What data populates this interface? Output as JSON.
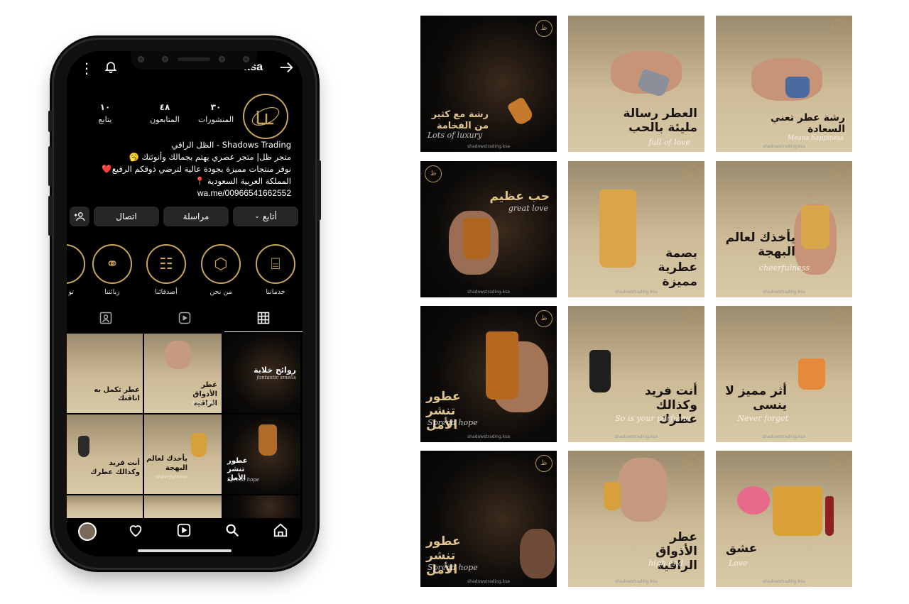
{
  "profile": {
    "username": "ksa",
    "stats": [
      {
        "value": "١٠",
        "label": "يتابع"
      },
      {
        "value": "٤٨",
        "label": "المتابعون"
      },
      {
        "value": "٣٠",
        "label": "المنشورات"
      }
    ],
    "bio_lines": [
      "Shadows Trading - الظل الراقي",
      "متجر ظل| متجر عصري يهتم بجمالك وأنوثتك 🥱",
      "نوفر منتجات مميزة بجودة عالية لترضي ذوقكم الرفيع❤️",
      "المملكة العربية السعودية 📍"
    ],
    "link": "wa.me/00966541662552",
    "buttons": {
      "follow": "أتابع",
      "message": "مراسلة",
      "contact": "اتصال",
      "add_user": "+"
    },
    "highlights": [
      {
        "label": "خدماتنا",
        "icon": "perfume-bottle-icon"
      },
      {
        "label": "من نحن",
        "icon": "box-icon"
      },
      {
        "label": "أصدقائنا",
        "icon": "people-icon"
      },
      {
        "label": "زبائننا",
        "icon": "customers-icon"
      },
      {
        "label": "تو",
        "icon": "partial-icon"
      }
    ]
  },
  "grid_posts": [
    {
      "text": "عطر تكمل به اناقتك"
    },
    {
      "text": "عطر الأذواق الراقية",
      "sub": "high end"
    },
    {
      "text": "روائح خلابة",
      "sub": "fantastic smells"
    },
    {
      "text": "أنت فريد وكذالك عطرك"
    },
    {
      "text": "يأخذك لعالم البهجة",
      "sub": "cheerfulness"
    },
    {
      "text": "عطور تنشر الأمل",
      "sub": "Spread hope"
    }
  ],
  "posts": [
    {
      "text": "رشة مع كثير من الفخامة",
      "sub": "Lots of luxury",
      "theme": "dark"
    },
    {
      "text": "العطر رسالة مليئة بالحب",
      "sub": "full of love",
      "theme": "light"
    },
    {
      "text": "رشة عطر تعني السعادة",
      "sub": "Means happiness",
      "theme": "light"
    },
    {
      "text": "حب عظيم",
      "sub": "great love",
      "theme": "dark"
    },
    {
      "text": "بصمة عطرية مميزة",
      "sub": "",
      "theme": "light"
    },
    {
      "text": "يأخذك لعالم البهجة",
      "sub": "cheerfulness",
      "theme": "light"
    },
    {
      "text": "عطور تنشر الأمل",
      "sub": "Spread hope",
      "theme": "dark"
    },
    {
      "text": "أنت فريد وكذالك عطرك",
      "sub": "So is your perfume",
      "theme": "light"
    },
    {
      "text": "أثر مميز لا ينسى",
      "sub": "Never forget",
      "theme": "light"
    },
    {
      "text": "عطور تنشر الأمل",
      "sub": "Spread hope",
      "theme": "dark"
    },
    {
      "text": "عطر الأذواق الراقية",
      "sub": "high end",
      "theme": "light"
    },
    {
      "text": "عشق",
      "sub": "Love",
      "theme": "light"
    }
  ],
  "handle": "shadowstrading.ksa",
  "colors": {
    "gold": "#c9a55c",
    "dark_bg": "#0b0907",
    "light_bg": "#cdbb97"
  }
}
